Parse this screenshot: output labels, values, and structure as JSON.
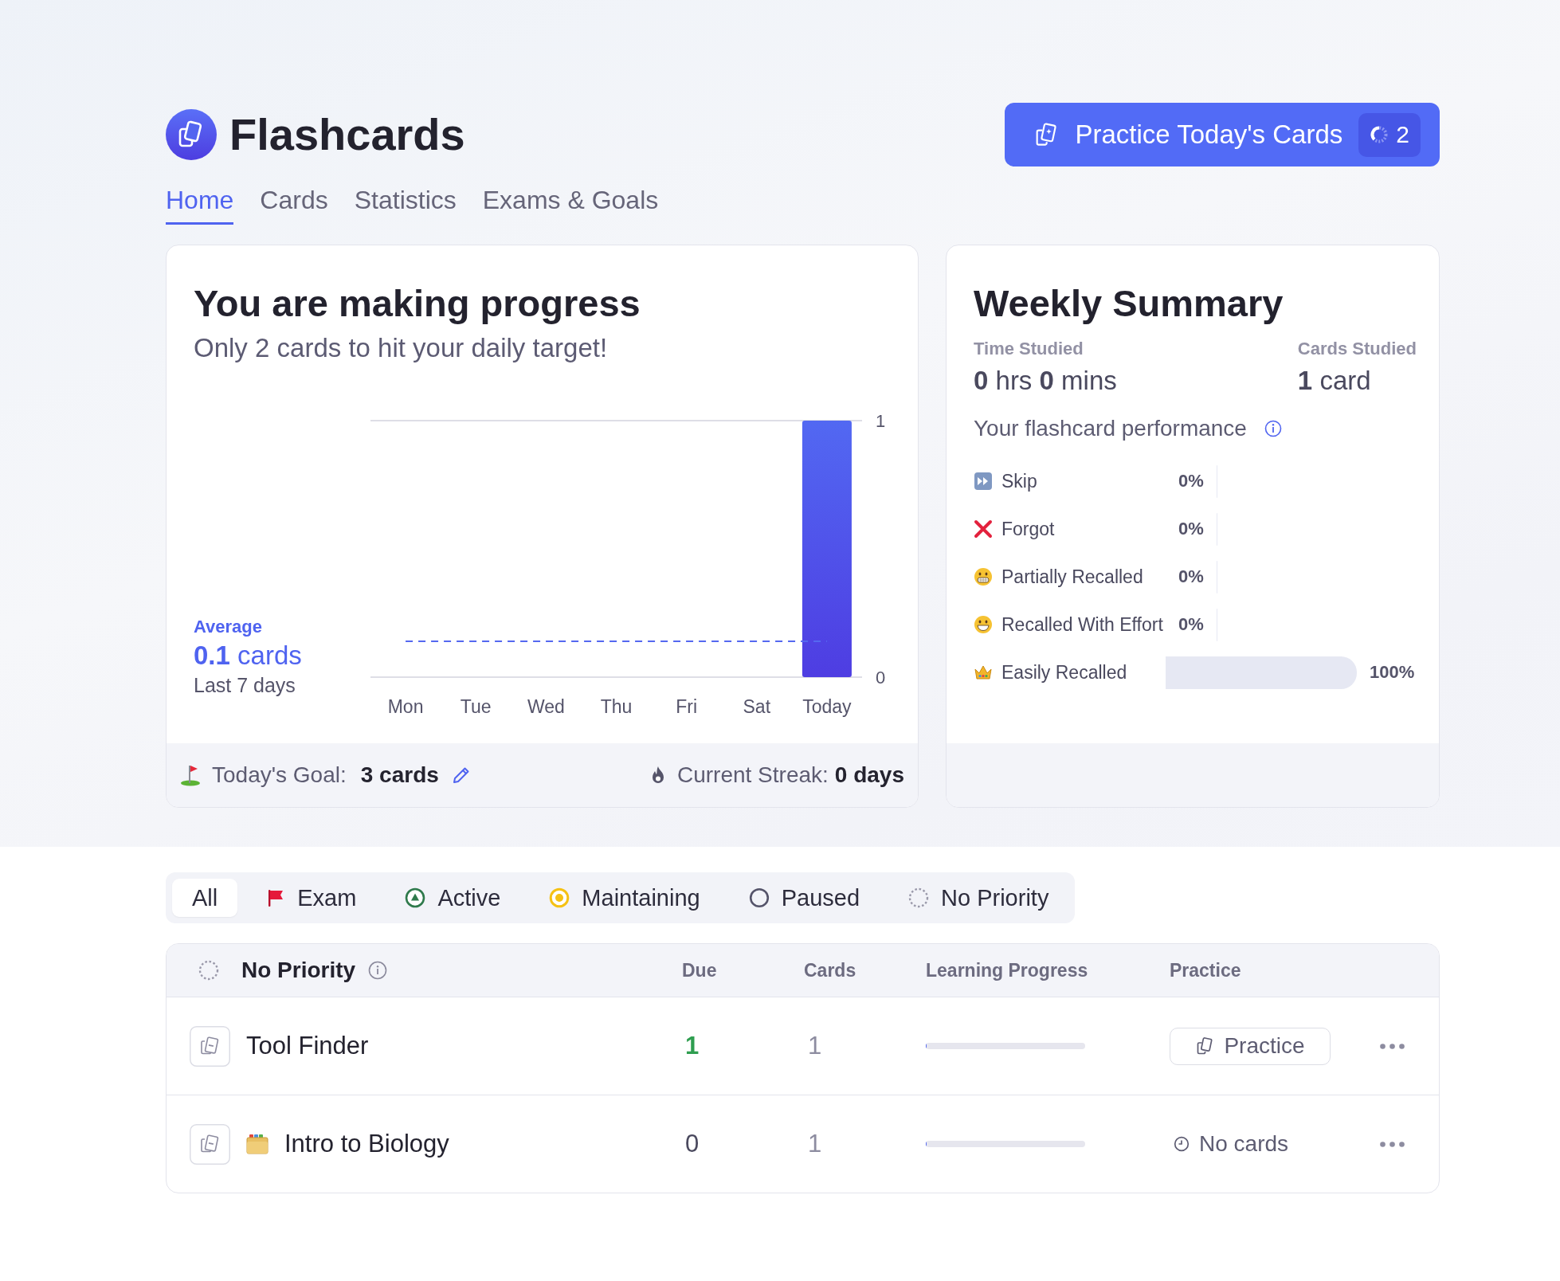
{
  "header": {
    "title": "Flashcards",
    "practice_button": {
      "label": "Practice Today's Cards",
      "count": "2"
    }
  },
  "tabs": [
    {
      "label": "Home",
      "selected": true
    },
    {
      "label": "Cards",
      "selected": false
    },
    {
      "label": "Statistics",
      "selected": false
    },
    {
      "label": "Exams & Goals",
      "selected": false
    }
  ],
  "progress_card": {
    "title": "You are making progress",
    "subtitle": "Only 2 cards to hit your daily target!",
    "average": {
      "label": "Average",
      "value": "**0.1** cards",
      "period": "Last 7 days"
    },
    "chart_data": {
      "type": "bar",
      "categories": [
        "Mon",
        "Tue",
        "Wed",
        "Thu",
        "Fri",
        "Sat",
        "Today"
      ],
      "values": [
        0,
        0,
        0,
        0,
        0,
        0,
        1
      ],
      "ylim": [
        0,
        1
      ],
      "yticks": [
        0,
        1
      ],
      "ref_lines": [
        {
          "axis": "y",
          "value": 0.14
        }
      ]
    },
    "goal": {
      "label": "Today's Goal:",
      "value": "3 cards"
    },
    "streak": {
      "label": "Current Streak:",
      "value": "0 days"
    }
  },
  "weekly_summary": {
    "title": "Weekly Summary",
    "time_studied": {
      "label": "Time Studied",
      "value": "**0** hrs **0** mins"
    },
    "cards_studied": {
      "label": "Cards Studied",
      "value": "**1** card"
    },
    "performance_title": "Your flashcard performance",
    "performance": [
      {
        "kind": "skip",
        "label": "Skip",
        "percent": "0%",
        "level": 0
      },
      {
        "kind": "forgot",
        "label": "Forgot",
        "percent": "0%",
        "level": 0
      },
      {
        "kind": "partial",
        "label": "Partially Recalled",
        "percent": "0%",
        "level": 0
      },
      {
        "kind": "effort",
        "label": "Recalled With Effort",
        "percent": "0%",
        "level": 0
      },
      {
        "kind": "easy",
        "label": "Easily Recalled",
        "percent": "100%",
        "level": 1
      }
    ]
  },
  "filters": [
    {
      "kind": "all",
      "label": "All",
      "selected": true
    },
    {
      "kind": "exam",
      "label": "Exam",
      "selected": false
    },
    {
      "kind": "active",
      "label": "Active",
      "selected": false
    },
    {
      "kind": "maintaining",
      "label": "Maintaining",
      "selected": false
    },
    {
      "kind": "paused",
      "label": "Paused",
      "selected": false
    },
    {
      "kind": "none",
      "label": "No Priority",
      "selected": false
    }
  ],
  "deck_table": {
    "group": "No Priority",
    "columns": [
      "Due",
      "Cards",
      "Learning Progress",
      "Practice"
    ],
    "rows": [
      {
        "name": "Tool Finder",
        "has_icon": false,
        "due": "1",
        "due_now": true,
        "cards": "1",
        "level": 0,
        "practice": {
          "kind": "button",
          "label": "Practice"
        }
      },
      {
        "name": "Intro to Biology",
        "has_icon": true,
        "due": "0",
        "due_now": false,
        "cards": "1",
        "level": 0,
        "practice": {
          "kind": "empty",
          "label": "No cards"
        }
      }
    ]
  }
}
